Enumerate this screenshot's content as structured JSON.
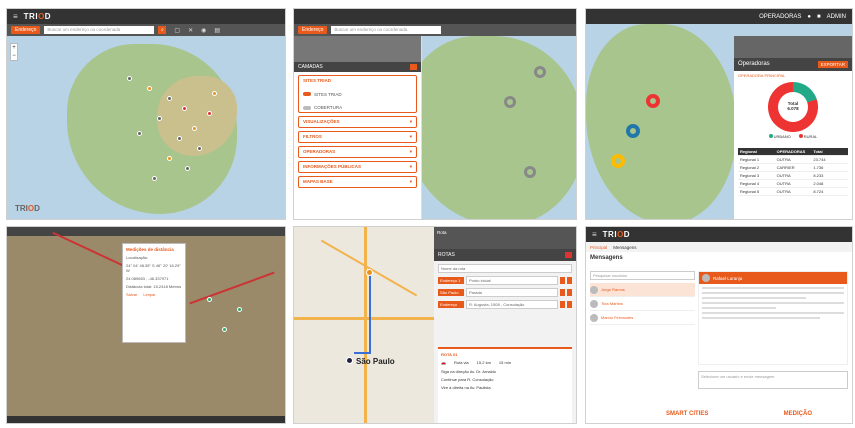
{
  "brand": {
    "logo_prefix": "TRI",
    "logo_accent": "O",
    "logo_suffix": "D",
    "accent_color": "#e85a1b"
  },
  "panel1": {
    "topbar_menu": "≡",
    "subbar_button": "Endereço",
    "search_placeholder": "Buscar um endereço ou coordenada",
    "zoom_in": "+",
    "zoom_out": "−"
  },
  "panel2": {
    "sidebar_title": "CAMADAS",
    "section_sites": "SITES TRIAD",
    "toggle_1": "SITES TRIAD",
    "toggle_2": "COBERTURA",
    "section_viz": "VISUALIZAÇÕES",
    "section_filters": "FILTROS",
    "section_ops": "OPERADORAS",
    "section_info": "INFORMAÇÕES PÚBLICAS",
    "section_base": "MAPAS BASE"
  },
  "panel3": {
    "top_label": "OPERADORAS",
    "user": "ADMIN",
    "card_title": "Operadoras",
    "card_button": "EXPORTAR",
    "chart_caption": "OPERADORA PRINCIPAL",
    "donut_label": "Total",
    "donut_value": "6.078",
    "legend": [
      "URBANO",
      "RURAL"
    ],
    "table_headers": [
      "Regional",
      "OPERADORAS",
      "Total"
    ],
    "table_rows": [
      [
        "Regional 1",
        "OUTRA",
        "23.744"
      ],
      [
        "Regional 2",
        "CARRIER",
        "1.736"
      ],
      [
        "Regional 3",
        "OUTRA",
        "8.233"
      ],
      [
        "Regional 4",
        "OUTRA",
        "2.048"
      ],
      [
        "Regional 5",
        "OUTRA",
        "8.724"
      ]
    ]
  },
  "panel4": {
    "popup_title": "Medições de distância",
    "popup_lines": [
      "Localização:",
      "24° 04' 48.35\" S  46° 20' 16.29\" W",
      "24.089653 , -46.337971",
      "Distância total: 15.2418 Metros"
    ],
    "popup_links": [
      "Salvar",
      "Limpar"
    ]
  },
  "panel5": {
    "tab_1": "Rota",
    "panel_title": "ROTAS",
    "name_placeholder": "Nome da rota",
    "stops": [
      {
        "label": "Endereço 1",
        "value": "Ponto inicial"
      },
      {
        "label": "São Paulo",
        "value": "Parada"
      },
      {
        "label": "Endereço",
        "value": "R. Augusta, 1508 - Consolação"
      }
    ],
    "city_label": "São Paulo",
    "card_title": "ROTA 01",
    "vehicle": "Rota via",
    "distance": "15,2 km",
    "time": "15 min",
    "steps": [
      "Siga na direção Av. Dr. Arnaldo",
      "Continue para R. Consolação",
      "Vire à direita na Av. Paulista"
    ]
  },
  "panel6": {
    "tab_home": "Principal",
    "tab_messages": "Mensagens",
    "title": "Mensagens",
    "search_placeholder": "Pesquisar usuários",
    "contacts": [
      "Jorge Ramos",
      "Tina Martins",
      "Marcio Fernandes"
    ],
    "active_contact": "Rafael Laranja",
    "reply_placeholder": "Selecione um usuário e envie mensagem",
    "footer_left": "SMART CITIES",
    "footer_right": "MEDIÇÃO"
  }
}
